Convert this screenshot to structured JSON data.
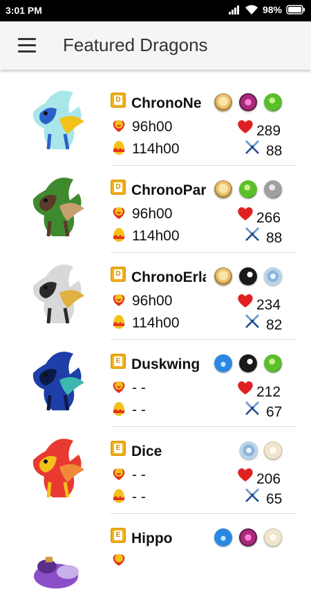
{
  "status": {
    "time": "3:01 PM",
    "battery": "98%"
  },
  "header": {
    "title": "Featured Dragons"
  },
  "colors": {
    "header_bg": "#f5f5f5",
    "badge": "#f2b21b",
    "heart": "#e02020"
  },
  "dragons": [
    {
      "name": "ChronoNe",
      "rarity": "D",
      "breed_time": "96h00",
      "hatch_time": "114h00",
      "hp": "289",
      "attack": "88",
      "elements": [
        "chrono-element-icon",
        "magic-element-icon",
        "nature-element-icon"
      ],
      "colors": [
        "#a8e6ea",
        "#2a62c8",
        "#f2c21b"
      ]
    },
    {
      "name": "ChronoPar",
      "rarity": "D",
      "breed_time": "96h00",
      "hatch_time": "114h00",
      "hp": "266",
      "attack": "88",
      "elements": [
        "chrono-element-icon",
        "nature-element-icon",
        "metal-element-icon"
      ],
      "colors": [
        "#3f8a2f",
        "#5a3a2a",
        "#c8a070"
      ]
    },
    {
      "name": "ChronoErla",
      "rarity": "D",
      "breed_time": "96h00",
      "hatch_time": "114h00",
      "hp": "234",
      "attack": "82",
      "elements": [
        "chrono-element-icon",
        "dark-element-icon",
        "wind-element-icon"
      ],
      "colors": [
        "#d8d8d8",
        "#2a2a2a",
        "#e0b040"
      ]
    },
    {
      "name": "Duskwing",
      "rarity": "E",
      "breed_time": "- -",
      "hatch_time": "- -",
      "hp": "212",
      "attack": "67",
      "elements": [
        "water-element-icon",
        "dark-element-icon",
        "nature-element-icon"
      ],
      "colors": [
        "#1e3fa8",
        "#0c1a4a",
        "#3cb8b0"
      ]
    },
    {
      "name": "Dice",
      "rarity": "E",
      "breed_time": "- -",
      "hatch_time": "- -",
      "hp": "206",
      "attack": "65",
      "elements": [
        "wind-element-icon",
        "light-element-icon"
      ],
      "colors": [
        "#e83a30",
        "#f2c21b",
        "#f08a3a"
      ]
    },
    {
      "name": "Hippo",
      "rarity": "E",
      "breed_time": "",
      "hatch_time": "",
      "hp": "",
      "attack": "",
      "elements": [
        "water-element-icon",
        "magic-element-icon",
        "light-element-icon"
      ],
      "colors": [
        "#8a4fc8",
        "#5a2f8a",
        "#c8b0e8"
      ]
    }
  ]
}
